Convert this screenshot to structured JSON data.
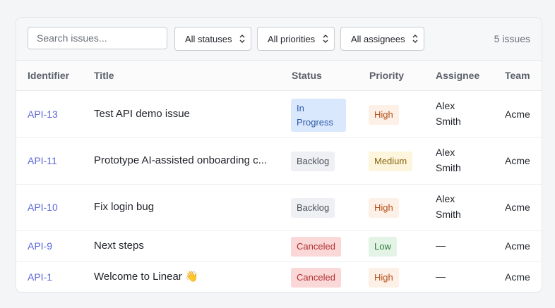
{
  "toolbar": {
    "search_placeholder": "Search issues...",
    "status_filter": "All statuses",
    "priority_filter": "All priorities",
    "assignee_filter": "All assignees",
    "issue_count": "5 issues"
  },
  "columns": {
    "identifier": "Identifier",
    "title": "Title",
    "status": "Status",
    "priority": "Priority",
    "assignee": "Assignee",
    "team": "Team"
  },
  "rows": [
    {
      "id": "API-13",
      "title": "Test API demo issue",
      "status": "In Progress",
      "priority": "High",
      "assignee_first": "Alex",
      "assignee_last": "Smith",
      "team": "Acme"
    },
    {
      "id": "API-11",
      "title": "Prototype AI-assisted onboarding c...",
      "status": "Backlog",
      "priority": "Medium",
      "assignee_first": "Alex",
      "assignee_last": "Smith",
      "team": "Acme"
    },
    {
      "id": "API-10",
      "title": "Fix login bug",
      "status": "Backlog",
      "priority": "High",
      "assignee_first": "Alex",
      "assignee_last": "Smith",
      "team": "Acme"
    },
    {
      "id": "API-9",
      "title": "Next steps",
      "status": "Canceled",
      "priority": "Low",
      "assignee_first": "—",
      "assignee_last": "",
      "team": "Acme"
    },
    {
      "id": "API-1",
      "title": "Welcome to Linear 👋",
      "status": "Canceled",
      "priority": "High",
      "assignee_first": "—",
      "assignee_last": "",
      "team": "Acme"
    }
  ],
  "colors": {
    "identifier": "#5b67d8",
    "status_in_progress_bg": "#d9e8fc",
    "status_backlog_bg": "#eef0f3",
    "status_canceled_bg": "#fbd8d8",
    "priority_high_bg": "#fdf0e6",
    "priority_medium_bg": "#fdf5dc",
    "priority_low_bg": "#e3f4e6"
  }
}
